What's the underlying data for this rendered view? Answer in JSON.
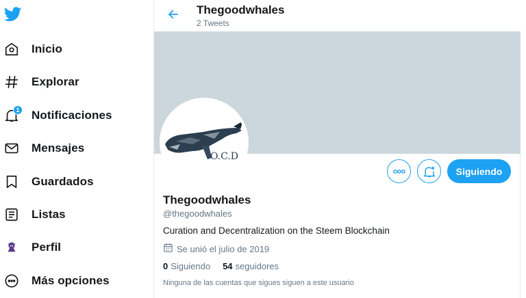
{
  "sidebar": {
    "items": [
      {
        "label": "Inicio",
        "icon": "home-icon"
      },
      {
        "label": "Explorar",
        "icon": "hashtag-icon"
      },
      {
        "label": "Notificaciones",
        "icon": "bell-icon",
        "badge": "1"
      },
      {
        "label": "Mensajes",
        "icon": "mail-icon"
      },
      {
        "label": "Guardados",
        "icon": "bookmark-icon"
      },
      {
        "label": "Listas",
        "icon": "list-icon"
      },
      {
        "label": "Perfil",
        "icon": "profile-avatar-icon"
      },
      {
        "label": "Más opciones",
        "icon": "more-icon"
      }
    ]
  },
  "header": {
    "title": "Thegoodwhales",
    "subtitle": "2 Tweets"
  },
  "profile": {
    "name": "Thegoodwhales",
    "handle": "@thegoodwhales",
    "bio": "Curation and Decentralization on the Steem Blockchain",
    "joined": "Se unió el julio de 2019",
    "following_count": "0",
    "following_label": "Siguiendo",
    "followers_count": "54",
    "followers_label": "seguidores",
    "followed_by_note": "Ninguna de las cuentas que sigues siguen a este usuario",
    "avatar_text": "O.C.D"
  },
  "actions": {
    "follow_label": "Siguiendo"
  },
  "colors": {
    "accent": "#1da1f2",
    "banner": "#ccd6dd",
    "secondary_text": "#657786"
  }
}
